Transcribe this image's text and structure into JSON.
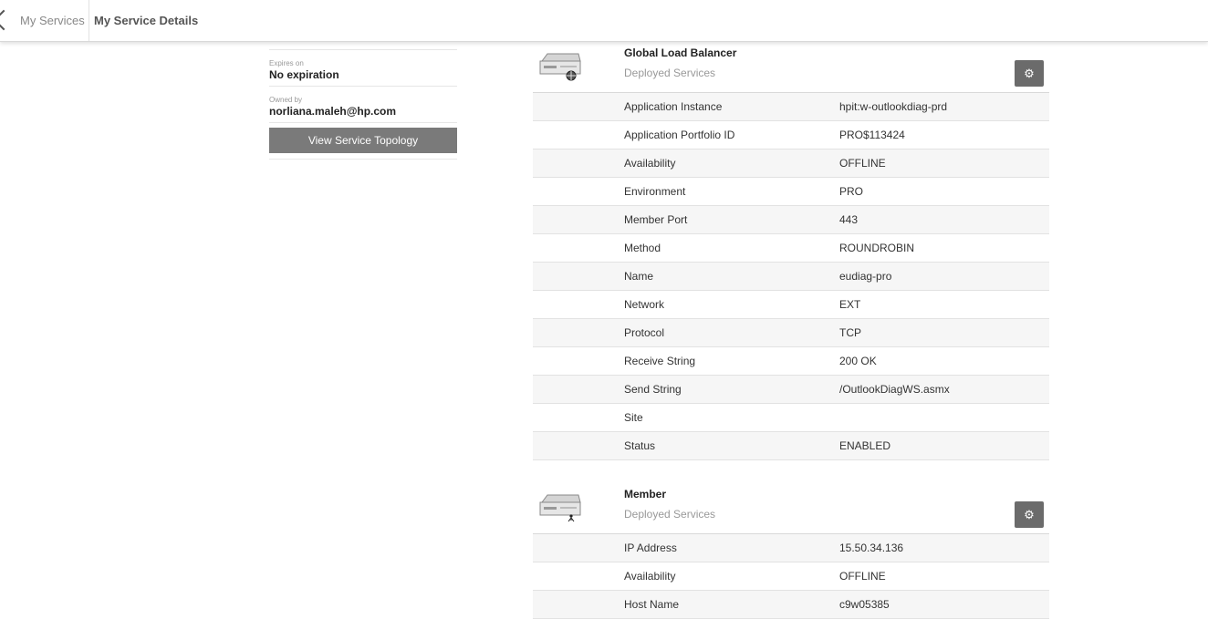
{
  "breadcrumb": {
    "parent": "My Services",
    "current": "My Service Details"
  },
  "sidebar": {
    "expires_label": "Expires on",
    "expires_value": "No expiration",
    "owner_label": "Owned by",
    "owner_value": "norliana.maleh@hp.com",
    "topology_button": "View Service Topology"
  },
  "sections": [
    {
      "title": "Global Load Balancer",
      "subtitle": "Deployed Services",
      "icon": "server-globe-icon",
      "rows": [
        {
          "key": "Application Instance",
          "value": "hpit:w-outlookdiag-prd"
        },
        {
          "key": "Application Portfolio ID",
          "value": "PRO$113424"
        },
        {
          "key": "Availability",
          "value": "OFFLINE"
        },
        {
          "key": "Environment",
          "value": "PRO"
        },
        {
          "key": "Member Port",
          "value": "443"
        },
        {
          "key": "Method",
          "value": "ROUNDROBIN"
        },
        {
          "key": "Name",
          "value": "eudiag-pro"
        },
        {
          "key": "Network",
          "value": "EXT"
        },
        {
          "key": "Protocol",
          "value": "TCP"
        },
        {
          "key": "Receive String",
          "value": "200 OK"
        },
        {
          "key": "Send String",
          "value": "/OutlookDiagWS.asmx"
        },
        {
          "key": "Site",
          "value": ""
        },
        {
          "key": "Status",
          "value": "ENABLED"
        }
      ]
    },
    {
      "title": "Member",
      "subtitle": "Deployed Services",
      "icon": "server-person-icon",
      "rows": [
        {
          "key": "IP Address",
          "value": "15.50.34.136"
        },
        {
          "key": "Availability",
          "value": "OFFLINE"
        },
        {
          "key": "Host Name",
          "value": "c9w05385"
        }
      ]
    }
  ]
}
